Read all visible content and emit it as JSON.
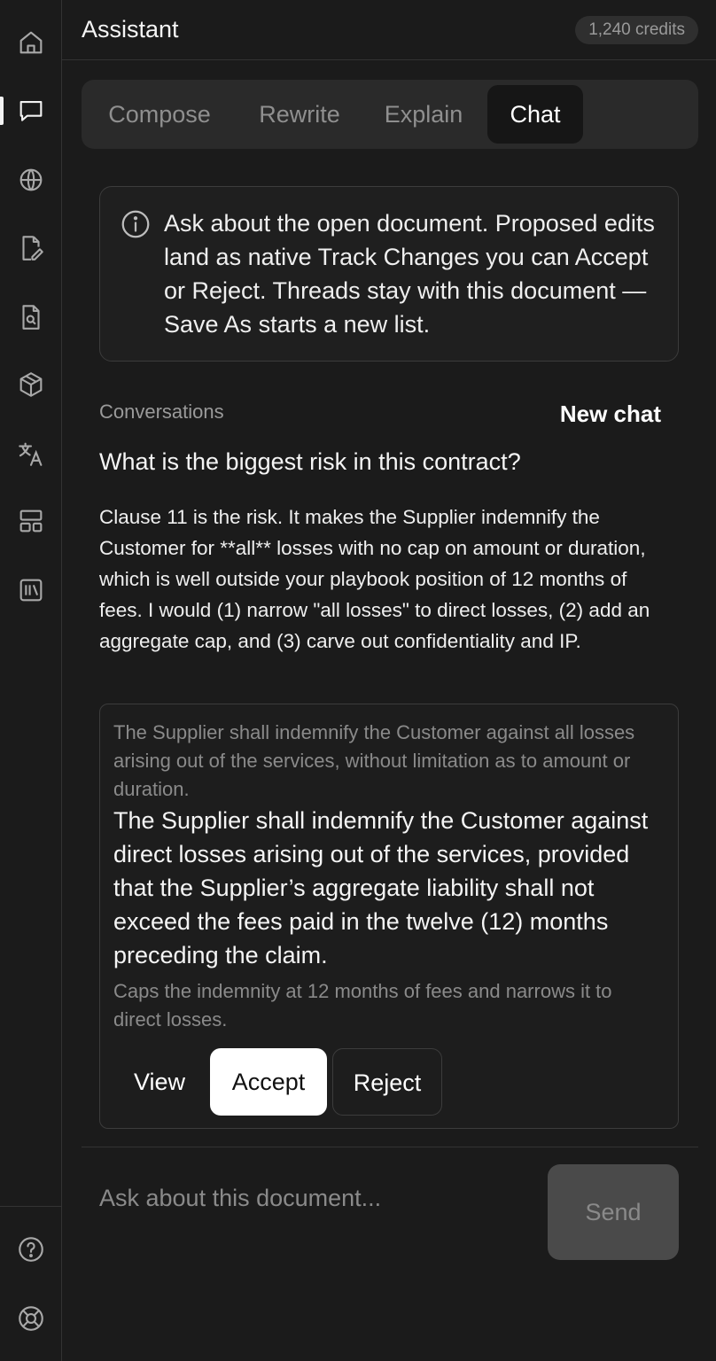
{
  "sidebar": {
    "items": [
      {
        "icon": "home-icon"
      },
      {
        "icon": "chat-icon",
        "active": true
      },
      {
        "icon": "globe-icon"
      },
      {
        "icon": "edit-document-icon"
      },
      {
        "icon": "search-document-icon"
      },
      {
        "icon": "cube-icon"
      },
      {
        "icon": "translate-icon"
      },
      {
        "icon": "layout-icon"
      },
      {
        "icon": "library-icon"
      }
    ],
    "bottom": [
      {
        "icon": "help-icon"
      },
      {
        "icon": "support-icon"
      }
    ]
  },
  "header": {
    "title": "Assistant",
    "credits": "1,240 credits"
  },
  "tabs": [
    {
      "label": "Compose"
    },
    {
      "label": "Rewrite"
    },
    {
      "label": "Explain"
    },
    {
      "label": "Chat",
      "active": true
    }
  ],
  "info": {
    "text": "Ask about the open document. Proposed edits land as native Track Changes you can Accept or Reject. Threads stay with this document — Save As starts a new list."
  },
  "conversations": {
    "label": "Conversations",
    "new_chat_label": "New chat"
  },
  "thread": {
    "question": "What is the biggest risk in this contract?",
    "answer": "Clause 11 is the risk. It makes the Supplier indemnify the Customer for **all** losses with no cap on amount or duration, which is well outside your playbook position of 12 months of fees. I would (1) narrow \"all losses\" to direct losses, (2) add an aggregate cap, and (3) carve out confidentiality and IP.",
    "edit": {
      "original": "The Supplier shall indemnify the Customer against all losses arising out of the services, without limitation as to amount or duration.",
      "proposed": "The Supplier shall indemnify the Customer against direct losses arising out of the services, provided that the Supplier’s aggregate liability shall not exceed the fees paid in the twelve (12) months preceding the claim.",
      "rationale": "Caps the indemnity at 12 months of fees and narrows it to direct losses.",
      "view_label": "View",
      "accept_label": "Accept",
      "reject_label": "Reject"
    }
  },
  "composer": {
    "placeholder": "Ask about this document...",
    "send_label": "Send"
  }
}
